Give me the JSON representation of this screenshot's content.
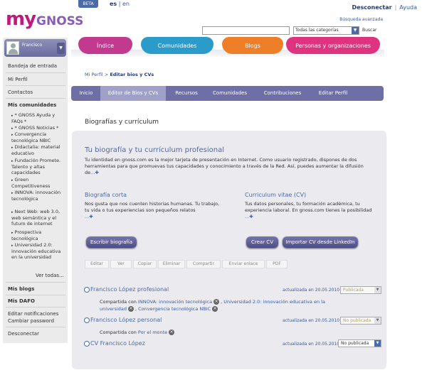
{
  "header": {
    "logo_my": "my",
    "logo_gnoss": "GNOSS",
    "beta": "BETA",
    "lang_es": "es",
    "lang_sep": " | ",
    "lang_en": "en",
    "disconnect": "Desconectar",
    "help": "Ayuda",
    "advanced_search": "Búsqueda avanzada",
    "search_value": "",
    "category": "Todas las categorías",
    "search_button": "Buscar"
  },
  "main_nav": [
    "Índice",
    "Comunidades",
    "Blogs",
    "Personas y organizaciones"
  ],
  "sidebar": {
    "user": "Francisco",
    "inbox": "Bandeja de entrada",
    "profile": "Mi Perfil",
    "contacts": "Contactos",
    "communities_heading": "Mis comunidades",
    "communities": [
      "* GNOSS Ayuda y FAQs *",
      "* GNOSS Noticias *",
      "Convergencia tecnológica NBIC",
      "Didactalia: material educativo",
      "Fundación Promete. Talento y altas capacidades",
      "Green Competitiveness",
      "INNOVA: innovación tecnológica",
      "Next Web: web 3.0, web semántica y el futuro de internet",
      "Prospectiva tecnológica",
      "Universidad 2.0: innovación educativa en la universidad"
    ],
    "see_all": "Ver todas...",
    "blogs": "Mis blogs",
    "dafo": "Mis DAFO",
    "edit_notifications": "Editar notificaciones",
    "change_password": "Cambiar password",
    "logout": "Desconectar"
  },
  "breadcrumb": {
    "profile": "Mi Perfil",
    "sep": " > ",
    "current": "Editar bios y CVs"
  },
  "sub_nav": [
    "Inicio",
    "Editor de Bios y CVs",
    "Recursos",
    "Comunidades",
    "Contribuciones",
    "Editar Perfil"
  ],
  "page_heading": "Biografías y currículum",
  "panel": {
    "title": "Tu biografía y tu currículum profesional",
    "desc": "Tu identidad en gnoss.com es la mejor tarjeta de presentación en Internet. Como usuario registrado, dispones de dos herramientas para que promuevas tus capacidades y conocimiento a través de la Red. Así, puedes aumentar la difusión de",
    "more": "...",
    "short_bio_title": "Biografía corta",
    "short_bio_text": "Nos gusta que nos cuenten historias humanas. Tu trabajo, tu vida o tus experiencias son pequeños relatos",
    "cv_title": "Curriculum vitae (CV)",
    "cv_text": "Tus datos personales, tu formación académica, tu experiencia laboral. En gnoss.com tienes la posibilidad",
    "write_bio": "Escribir biografía",
    "create_cv": "Crear CV",
    "import_cv": "Importar CV desde LinkedIn"
  },
  "toolbar": [
    "Editar",
    "Ver",
    "Copiar",
    "Eliminar",
    "Compartir",
    "Enviar enlace",
    "PDF"
  ],
  "rows": [
    {
      "title": "Francisco López profesional",
      "updated": "actualizada en 20.05.2010",
      "status": "Publicada",
      "shared_label": "Compartida con",
      "shared_1": "INNOVA: innovación tecnológica",
      "shared_2": "Universidad 2.0: innovación educativa en la universidad",
      "shared_3": "Convergencia tecnológica NBIC"
    },
    {
      "title": "Francisco López personal",
      "updated": "actualizada en 20.05.2010",
      "status": "No publicada",
      "shared_label": "Compartida con",
      "shared_1": "Por el monte"
    },
    {
      "title": "CV Francisco López",
      "updated": "actualizada en 20.05.2010",
      "status": "No publicada"
    }
  ]
}
